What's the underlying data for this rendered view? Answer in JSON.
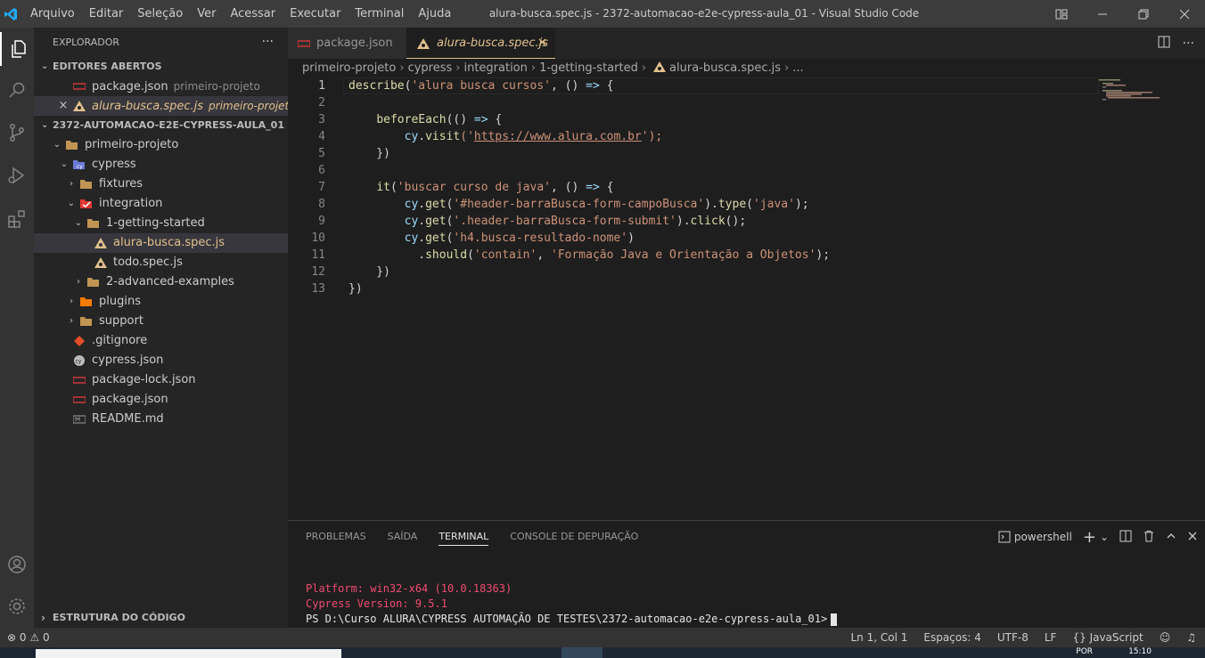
{
  "titlebar": {
    "menu": [
      "Arquivo",
      "Editar",
      "Seleção",
      "Ver",
      "Acessar",
      "Executar",
      "Terminal",
      "Ajuda"
    ],
    "window_title": "alura-busca.spec.js - 2372-automacao-e2e-cypress-aula_01 - Visual Studio Code"
  },
  "sidebar": {
    "header": "EXPLORADOR",
    "open_editors_title": "EDITORES ABERTOS",
    "open_editors": [
      {
        "name": "package.json",
        "hint": "primeiro-projeto"
      },
      {
        "name": "alura-busca.spec.js",
        "hint": "primeiro-projeto\\cy..."
      }
    ],
    "project_title": "2372-AUTOMACAO-E2E-CYPRESS-AULA_01",
    "tree": [
      "primeiro-projeto",
      "cypress",
      "fixtures",
      "integration",
      "1-getting-started",
      "alura-busca.spec.js",
      "todo.spec.js",
      "2-advanced-examples",
      "plugins",
      "support",
      ".gitignore",
      "cypress.json",
      "package-lock.json",
      "package.json",
      "README.md"
    ],
    "outline_title": "ESTRUTURA DO CÓDIGO"
  },
  "editor": {
    "tabs": [
      "package.json",
      "alura-busca.spec.js"
    ],
    "breadcrumb": [
      "primeiro-projeto",
      "cypress",
      "integration",
      "1-getting-started",
      "alura-busca.spec.js",
      "..."
    ],
    "line_numbers": [
      "1",
      "2",
      "3",
      "4",
      "5",
      "6",
      "7",
      "8",
      "9",
      "10",
      "11",
      "12",
      "13"
    ],
    "code": {
      "l1": [
        "describe",
        "(",
        "'alura busca cursos'",
        ", () ",
        "=>",
        " {"
      ],
      "l3": [
        "    ",
        "beforeEach",
        "(() ",
        "=>",
        " {"
      ],
      "l4": [
        "        ",
        "cy",
        ".",
        "visit",
        "('",
        "https://www.alura.com.br",
        "');"
      ],
      "l5": "    })",
      "l7": [
        "    ",
        "it",
        "(",
        "'buscar curso de java'",
        ", () ",
        "=>",
        " {"
      ],
      "l8": [
        "        ",
        "cy",
        ".",
        "get",
        "(",
        "'#header-barraBusca-form-campoBusca'",
        ").",
        "type",
        "(",
        "'java'",
        ");"
      ],
      "l9": [
        "        ",
        "cy",
        ".",
        "get",
        "(",
        "'.header-barraBusca-form-submit'",
        ").",
        "click",
        "();"
      ],
      "l10": [
        "        ",
        "cy",
        ".",
        "get",
        "(",
        "'h4.busca-resultado-nome'",
        ")"
      ],
      "l11": [
        "          .",
        "should",
        "(",
        "'contain'",
        ", ",
        "'Formação Java e Orientação a Objetos'",
        ");"
      ],
      "l12": "    })",
      "l13": "})"
    }
  },
  "panel": {
    "tabs": [
      "PROBLEMAS",
      "SAÍDA",
      "TERMINAL",
      "CONSOLE DE DEPURAÇÃO"
    ],
    "shell": "powershell",
    "terminal_lines": [
      "Platform: win32-x64 (10.0.18363)",
      "Cypress Version: 9.5.1",
      "PS D:\\Curso ALURA\\CYPRESS AUTOMAÇÃO DE TESTES\\2372-automacao-e2e-cypress-aula_01>"
    ]
  },
  "statusbar": {
    "problems": "0",
    "warnings": "0",
    "position": "Ln 1, Col 1",
    "spaces": "Espaços: 4",
    "encoding": "UTF-8",
    "eol": "LF",
    "language": "JavaScript"
  },
  "taskbar": {
    "lang": "POR",
    "time": "15:10"
  },
  "colors": {
    "accent": "#0078d4",
    "modified_file": "#e2c08d",
    "terminal_text": "#f14c71"
  }
}
